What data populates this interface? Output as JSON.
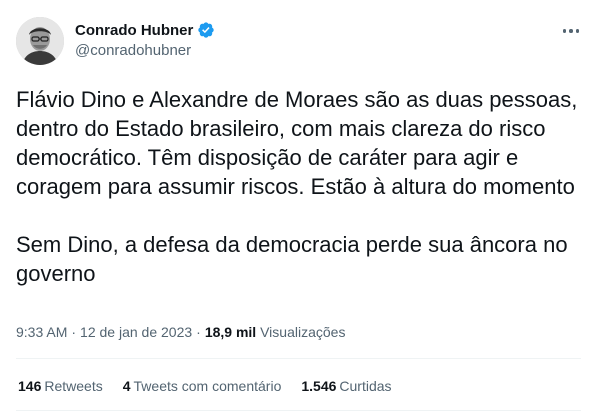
{
  "tweet": {
    "author": {
      "name": "Conrado Hubner",
      "handle": "@conradohubner",
      "verified_icon": "verified-badge-icon",
      "avatar_icon": "avatar-photo"
    },
    "more_icon": "more-options-icon",
    "paragraphs": [
      "Flávio Dino e Alexandre de Moraes são as duas pessoas, dentro do Estado brasileiro, com mais clareza do risco democrático. Têm disposição de caráter para agir e coragem para assumir riscos. Estão à altura do momento",
      "Sem Dino, a defesa da democracia perde sua âncora no governo"
    ],
    "meta": {
      "time": "9:33 AM",
      "separator": "·",
      "date": "12 de jan de 2023",
      "views_count": "18,9 mil",
      "views_label": "Visualizações"
    },
    "stats": [
      {
        "count": "146",
        "label": "Retweets"
      },
      {
        "count": "4",
        "label": "Tweets com comentário"
      },
      {
        "count": "1.546",
        "label": "Curtidas"
      }
    ]
  },
  "colors": {
    "text_primary": "#0f1419",
    "text_secondary": "#536471",
    "verified_blue": "#1d9bf0",
    "divider": "#eff3f4"
  }
}
